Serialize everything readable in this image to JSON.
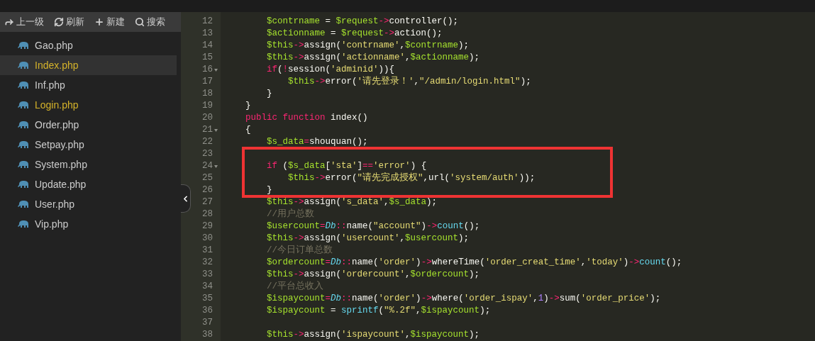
{
  "sidebar": {
    "toolbar": [
      {
        "kind": "forward",
        "label": "上一级"
      },
      {
        "kind": "refresh",
        "label": "刷新"
      },
      {
        "kind": "plus",
        "label": "新建"
      },
      {
        "kind": "search",
        "label": "搜索"
      }
    ],
    "files": [
      {
        "name": "Gao.php",
        "open": false,
        "selected": false
      },
      {
        "name": "Index.php",
        "open": true,
        "selected": true
      },
      {
        "name": "Inf.php",
        "open": false,
        "selected": false
      },
      {
        "name": "Login.php",
        "open": true,
        "selected": false
      },
      {
        "name": "Order.php",
        "open": false,
        "selected": false
      },
      {
        "name": "Setpay.php",
        "open": false,
        "selected": false
      },
      {
        "name": "System.php",
        "open": false,
        "selected": false
      },
      {
        "name": "Update.php",
        "open": false,
        "selected": false
      },
      {
        "name": "User.php",
        "open": false,
        "selected": false
      },
      {
        "name": "Vip.php",
        "open": false,
        "selected": false
      }
    ]
  },
  "editor": {
    "lines": [
      {
        "number": "12",
        "fold": false,
        "highlighted": false,
        "tokens": [
          {
            "kind": "var",
            "text": "        $contrname"
          },
          {
            "kind": "plain",
            "text": " = "
          },
          {
            "kind": "var",
            "text": "$request"
          },
          {
            "kind": "op",
            "text": "->"
          },
          {
            "kind": "plain",
            "text": "controller();"
          }
        ]
      },
      {
        "number": "13",
        "fold": false,
        "highlighted": false,
        "tokens": [
          {
            "kind": "var",
            "text": "        $actionname"
          },
          {
            "kind": "plain",
            "text": " = "
          },
          {
            "kind": "var",
            "text": "$request"
          },
          {
            "kind": "op",
            "text": "->"
          },
          {
            "kind": "plain",
            "text": "action();"
          }
        ]
      },
      {
        "number": "14",
        "fold": false,
        "highlighted": false,
        "tokens": [
          {
            "kind": "var",
            "text": "        $this"
          },
          {
            "kind": "op",
            "text": "->"
          },
          {
            "kind": "plain",
            "text": "assign("
          },
          {
            "kind": "str",
            "text": "'contrname'"
          },
          {
            "kind": "plain",
            "text": ","
          },
          {
            "kind": "var",
            "text": "$contrname"
          },
          {
            "kind": "plain",
            "text": ");"
          }
        ]
      },
      {
        "number": "15",
        "fold": false,
        "highlighted": false,
        "tokens": [
          {
            "kind": "var",
            "text": "        $this"
          },
          {
            "kind": "op",
            "text": "->"
          },
          {
            "kind": "plain",
            "text": "assign("
          },
          {
            "kind": "str",
            "text": "'actionname'"
          },
          {
            "kind": "plain",
            "text": ","
          },
          {
            "kind": "var",
            "text": "$actionname"
          },
          {
            "kind": "plain",
            "text": ");"
          }
        ]
      },
      {
        "number": "16",
        "fold": true,
        "highlighted": false,
        "tokens": [
          {
            "kind": "keyword",
            "text": "        if"
          },
          {
            "kind": "plain",
            "text": "("
          },
          {
            "kind": "op",
            "text": "!"
          },
          {
            "kind": "plain",
            "text": "session("
          },
          {
            "kind": "str",
            "text": "'adminid'"
          },
          {
            "kind": "plain",
            "text": ")){"
          }
        ]
      },
      {
        "number": "17",
        "fold": false,
        "highlighted": false,
        "tokens": [
          {
            "kind": "var",
            "text": "            $this"
          },
          {
            "kind": "op",
            "text": "->"
          },
          {
            "kind": "plain",
            "text": "error("
          },
          {
            "kind": "str",
            "text": "'请先登录！'"
          },
          {
            "kind": "plain",
            "text": ","
          },
          {
            "kind": "str",
            "text": "\"/admin/login.html\""
          },
          {
            "kind": "plain",
            "text": ");"
          }
        ]
      },
      {
        "number": "18",
        "fold": false,
        "highlighted": false,
        "tokens": [
          {
            "kind": "plain",
            "text": "        }"
          }
        ]
      },
      {
        "number": "19",
        "fold": false,
        "highlighted": false,
        "tokens": [
          {
            "kind": "plain",
            "text": "    }"
          }
        ]
      },
      {
        "number": "20",
        "fold": false,
        "highlighted": false,
        "tokens": [
          {
            "kind": "keyword",
            "text": "    public function"
          },
          {
            "kind": "plain",
            "text": " index()"
          }
        ]
      },
      {
        "number": "21",
        "fold": true,
        "highlighted": false,
        "tokens": [
          {
            "kind": "plain",
            "text": "    {"
          }
        ]
      },
      {
        "number": "22",
        "fold": false,
        "highlighted": false,
        "tokens": [
          {
            "kind": "var",
            "text": "        $s_data"
          },
          {
            "kind": "op",
            "text": "="
          },
          {
            "kind": "plain",
            "text": "shouquan();"
          }
        ]
      },
      {
        "number": "23",
        "fold": false,
        "highlighted": true
      },
      {
        "number": "24",
        "fold": true,
        "highlighted": true,
        "tokens": [
          {
            "kind": "keyword",
            "text": "        if"
          },
          {
            "kind": "plain",
            "text": " ("
          },
          {
            "kind": "var",
            "text": "$s_data"
          },
          {
            "kind": "plain",
            "text": "["
          },
          {
            "kind": "str",
            "text": "'sta'"
          },
          {
            "kind": "plain",
            "text": "]"
          },
          {
            "kind": "op",
            "text": "=="
          },
          {
            "kind": "str",
            "text": "'error'"
          },
          {
            "kind": "plain",
            "text": ") {"
          }
        ]
      },
      {
        "number": "25",
        "fold": false,
        "highlighted": true,
        "tokens": [
          {
            "kind": "var",
            "text": "            $this"
          },
          {
            "kind": "op",
            "text": "->"
          },
          {
            "kind": "plain",
            "text": "error("
          },
          {
            "kind": "str",
            "text": "\"请先完成授权\""
          },
          {
            "kind": "plain",
            "text": ",url("
          },
          {
            "kind": "str",
            "text": "'system/auth'"
          },
          {
            "kind": "plain",
            "text": "));"
          }
        ]
      },
      {
        "number": "26",
        "fold": false,
        "highlighted": true,
        "tokens": [
          {
            "kind": "plain",
            "text": "        }"
          }
        ]
      },
      {
        "number": "27",
        "fold": false,
        "highlighted": false,
        "tokens": [
          {
            "kind": "var",
            "text": "        $this"
          },
          {
            "kind": "op",
            "text": "->"
          },
          {
            "kind": "plain",
            "text": "assign("
          },
          {
            "kind": "str",
            "text": "'s_data'"
          },
          {
            "kind": "plain",
            "text": ","
          },
          {
            "kind": "var",
            "text": "$s_data"
          },
          {
            "kind": "plain",
            "text": ");"
          }
        ]
      },
      {
        "number": "28",
        "fold": false,
        "highlighted": false,
        "tokens": [
          {
            "kind": "comment",
            "text": "        //用户总数"
          }
        ]
      },
      {
        "number": "29",
        "fold": false,
        "highlighted": false,
        "tokens": [
          {
            "kind": "var",
            "text": "        $usercount"
          },
          {
            "kind": "op",
            "text": "="
          },
          {
            "kind": "class",
            "text": "Db"
          },
          {
            "kind": "op",
            "text": "::"
          },
          {
            "kind": "plain",
            "text": "name("
          },
          {
            "kind": "str",
            "text": "\"account\""
          },
          {
            "kind": "plain",
            "text": ")"
          },
          {
            "kind": "op",
            "text": "->"
          },
          {
            "kind": "builtin",
            "text": "count"
          },
          {
            "kind": "plain",
            "text": "();"
          }
        ]
      },
      {
        "number": "30",
        "fold": false,
        "highlighted": false,
        "tokens": [
          {
            "kind": "var",
            "text": "        $this"
          },
          {
            "kind": "op",
            "text": "->"
          },
          {
            "kind": "plain",
            "text": "assign("
          },
          {
            "kind": "str",
            "text": "'usercount'"
          },
          {
            "kind": "plain",
            "text": ","
          },
          {
            "kind": "var",
            "text": "$usercount"
          },
          {
            "kind": "plain",
            "text": ");"
          }
        ]
      },
      {
        "number": "31",
        "fold": false,
        "highlighted": false,
        "tokens": [
          {
            "kind": "comment",
            "text": "        //今日订单总数"
          }
        ]
      },
      {
        "number": "32",
        "fold": false,
        "highlighted": false,
        "tokens": [
          {
            "kind": "var",
            "text": "        $ordercount"
          },
          {
            "kind": "op",
            "text": "="
          },
          {
            "kind": "class",
            "text": "Db"
          },
          {
            "kind": "op",
            "text": "::"
          },
          {
            "kind": "plain",
            "text": "name("
          },
          {
            "kind": "str",
            "text": "'order'"
          },
          {
            "kind": "plain",
            "text": ")"
          },
          {
            "kind": "op",
            "text": "->"
          },
          {
            "kind": "plain",
            "text": "whereTime("
          },
          {
            "kind": "str",
            "text": "'order_creat_time'"
          },
          {
            "kind": "plain",
            "text": ","
          },
          {
            "kind": "str",
            "text": "'today'"
          },
          {
            "kind": "plain",
            "text": ")"
          },
          {
            "kind": "op",
            "text": "->"
          },
          {
            "kind": "builtin",
            "text": "count"
          },
          {
            "kind": "plain",
            "text": "();"
          }
        ]
      },
      {
        "number": "33",
        "fold": false,
        "highlighted": false,
        "tokens": [
          {
            "kind": "var",
            "text": "        $this"
          },
          {
            "kind": "op",
            "text": "->"
          },
          {
            "kind": "plain",
            "text": "assign("
          },
          {
            "kind": "str",
            "text": "'ordercount'"
          },
          {
            "kind": "plain",
            "text": ","
          },
          {
            "kind": "var",
            "text": "$ordercount"
          },
          {
            "kind": "plain",
            "text": ");"
          }
        ]
      },
      {
        "number": "34",
        "fold": false,
        "highlighted": false,
        "tokens": [
          {
            "kind": "comment",
            "text": "        //平台总收入"
          }
        ]
      },
      {
        "number": "35",
        "fold": false,
        "highlighted": false,
        "tokens": [
          {
            "kind": "var",
            "text": "        $ispaycount"
          },
          {
            "kind": "op",
            "text": "="
          },
          {
            "kind": "class",
            "text": "Db"
          },
          {
            "kind": "op",
            "text": "::"
          },
          {
            "kind": "plain",
            "text": "name("
          },
          {
            "kind": "str",
            "text": "'order'"
          },
          {
            "kind": "plain",
            "text": ")"
          },
          {
            "kind": "op",
            "text": "->"
          },
          {
            "kind": "plain",
            "text": "where("
          },
          {
            "kind": "str",
            "text": "'order_ispay'"
          },
          {
            "kind": "plain",
            "text": ","
          },
          {
            "kind": "num",
            "text": "1"
          },
          {
            "kind": "plain",
            "text": ")"
          },
          {
            "kind": "op",
            "text": "->"
          },
          {
            "kind": "plain",
            "text": "sum("
          },
          {
            "kind": "str",
            "text": "'order_price'"
          },
          {
            "kind": "plain",
            "text": ");"
          }
        ]
      },
      {
        "number": "36",
        "fold": false,
        "highlighted": false,
        "tokens": [
          {
            "kind": "var",
            "text": "        $ispaycount"
          },
          {
            "kind": "plain",
            "text": " = "
          },
          {
            "kind": "builtin",
            "text": "sprintf"
          },
          {
            "kind": "plain",
            "text": "("
          },
          {
            "kind": "str",
            "text": "\"%.2f\""
          },
          {
            "kind": "plain",
            "text": ","
          },
          {
            "kind": "var",
            "text": "$ispaycount"
          },
          {
            "kind": "plain",
            "text": ");"
          }
        ]
      },
      {
        "number": "37",
        "fold": false,
        "highlighted": false
      },
      {
        "number": "38",
        "fold": false,
        "highlighted": false,
        "tokens": [
          {
            "kind": "var",
            "text": "        $this"
          },
          {
            "kind": "op",
            "text": "->"
          },
          {
            "kind": "plain",
            "text": "assign("
          },
          {
            "kind": "str",
            "text": "'ispaycount'"
          },
          {
            "kind": "plain",
            "text": ","
          },
          {
            "kind": "var",
            "text": "$ispaycount"
          },
          {
            "kind": "plain",
            "text": ");"
          }
        ]
      }
    ]
  }
}
